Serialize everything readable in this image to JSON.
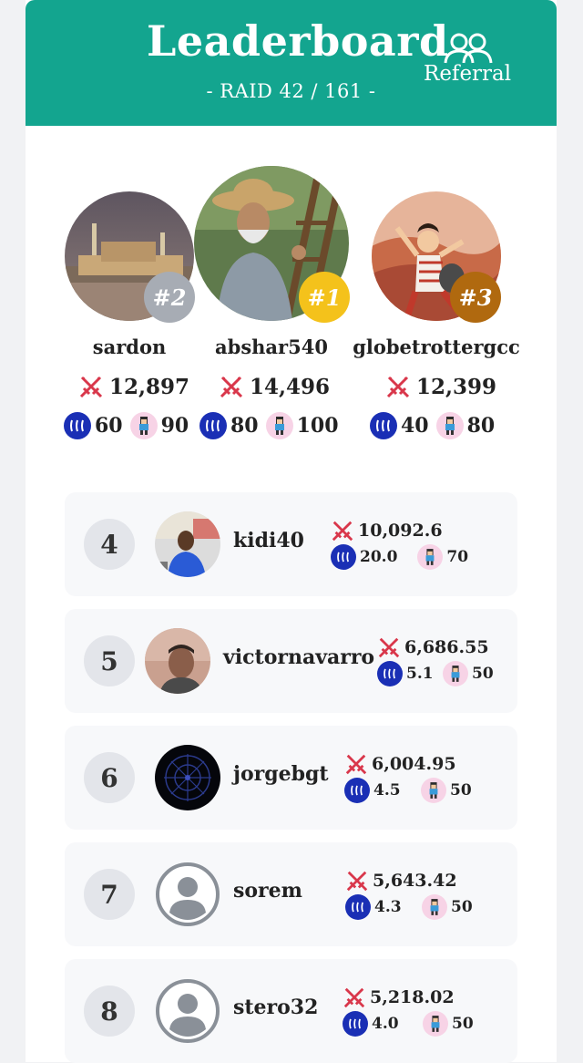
{
  "header": {
    "title": "Leaderboard",
    "referral_label": "Referral",
    "raid_label": "- RAID 42 / 161 -",
    "color": "#13a58f"
  },
  "icons": {
    "referral": "users-icon",
    "score": "crossed-swords-icon",
    "steem": "steem-icon",
    "character": "character-icon"
  },
  "podium": [
    {
      "rank": "#2",
      "name": "sardon",
      "score": "12,897",
      "steem": "60",
      "char": "90",
      "badge_color": "#a7acb4"
    },
    {
      "rank": "#1",
      "name": "abshar540",
      "score": "14,496",
      "steem": "80",
      "char": "100",
      "badge_color": "#f4c21b"
    },
    {
      "rank": "#3",
      "name": "globetrottergcc",
      "score": "12,399",
      "steem": "40",
      "char": "80",
      "badge_color": "#b0690f"
    }
  ],
  "rows": [
    {
      "rank": "4",
      "name": "kidi40",
      "score": "10,092.6",
      "steem": "20.0",
      "char": "70"
    },
    {
      "rank": "5",
      "name": "victornavarro",
      "score": "6,686.55",
      "steem": "5.1",
      "char": "50"
    },
    {
      "rank": "6",
      "name": "jorgebgt",
      "score": "6,004.95",
      "steem": "4.5",
      "char": "50"
    },
    {
      "rank": "7",
      "name": "sorem",
      "score": "5,643.42",
      "steem": "4.3",
      "char": "50"
    },
    {
      "rank": "8",
      "name": "stero32",
      "score": "5,218.02",
      "steem": "4.0",
      "char": "50"
    }
  ]
}
